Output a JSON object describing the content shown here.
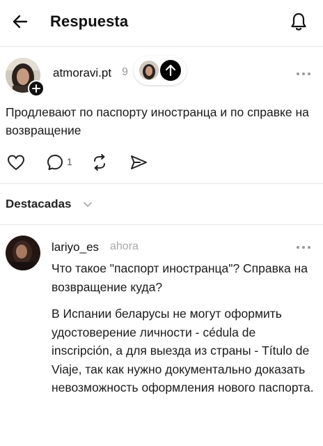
{
  "header": {
    "title": "Respuesta",
    "back_icon": "arrow-left-icon",
    "bell_icon": "bell-icon"
  },
  "post": {
    "username": "atmoravi.pt",
    "time": "9",
    "text": "Продлевают по паспорту иностранца и по справке на возвращение",
    "reply_count": "1",
    "icons": [
      "heart-icon",
      "comment-icon",
      "repost-icon",
      "share-icon"
    ]
  },
  "featured": {
    "label": "Destacadas"
  },
  "reply": {
    "username": "lariyo_es",
    "time": "ahora",
    "paragraphs": [
      "Что такое \"паспорт иностранца\"? Справка на возвращение куда?",
      "В Испании беларусы не могут оформить удостоверение личности - cédula de inscripción,  а для выезда из страны - Título de Viaje, так как нужно документально доказать невозможность оформления нового паспорта."
    ]
  },
  "colors": {
    "text": "#111111",
    "muted": "#9a9a9a",
    "divider": "#e6e6e6",
    "badge": "#000000"
  }
}
